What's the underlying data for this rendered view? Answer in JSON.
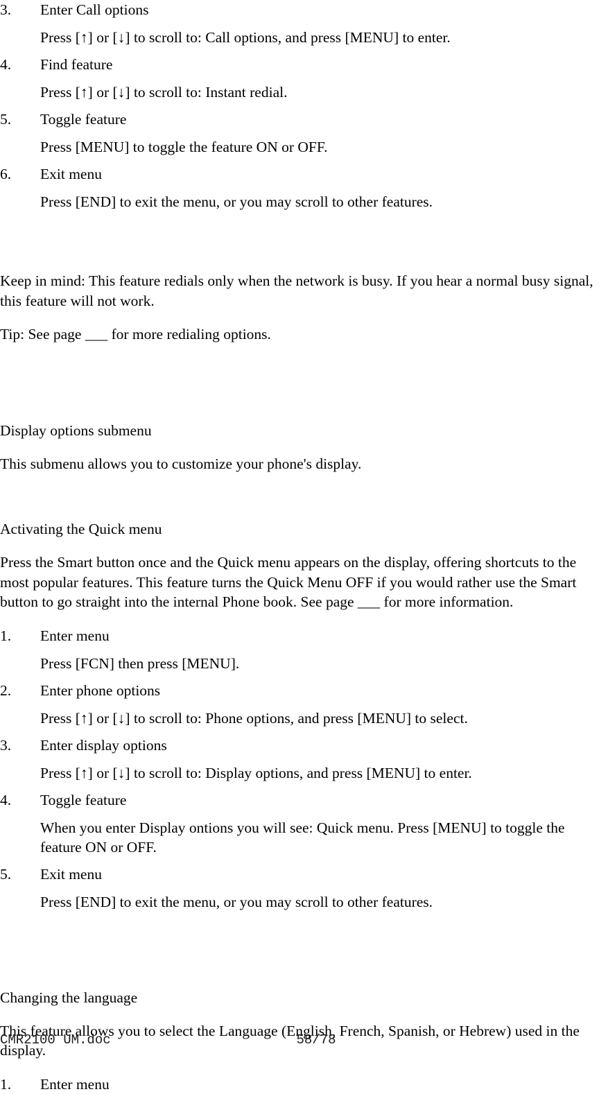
{
  "document": {
    "sections": [
      {
        "id": "instant-redial-steps",
        "steps": [
          {
            "num": "3.",
            "title": "Enter Call options",
            "body": "Press [↑] or [↓] to scroll to: Call options, and press [MENU] to enter."
          },
          {
            "num": "4.",
            "title": "Find feature",
            "body": "Press [↑] or [↓] to scroll to: Instant redial."
          },
          {
            "num": "5.",
            "title": "Toggle feature",
            "body": "Press [MENU] to toggle the feature ON or OFF."
          },
          {
            "num": "6.",
            "title": "Exit menu",
            "body": "Press [END] to exit the menu, or you may scroll to other features."
          }
        ]
      }
    ],
    "keep_in_mind": "Keep in mind:  This feature redials only when the network is busy. If you hear a normal busy signal, this feature will not work.",
    "tip": "Tip:  See page ___ for more redialing options.",
    "display_options": {
      "heading": "Display options submenu",
      "intro": "This submenu allows you to customize your phone's display."
    },
    "quick_menu": {
      "heading": "Activating the Quick menu",
      "intro": "Press the Smart button once and the Quick menu appears on the display, offering shortcuts to the most popular features. This feature turns the Quick Menu OFF if you would rather use the Smart button to go straight into the internal Phone book. See page ___ for more information.",
      "steps": [
        {
          "num": "1.",
          "title": "Enter menu",
          "body": "Press [FCN] then press [MENU]."
        },
        {
          "num": "2.",
          "title": "Enter phone options",
          "body": "Press [↑] or [↓] to scroll to: Phone options, and press [MENU] to select."
        },
        {
          "num": "3.",
          "title": "Enter display options",
          "body": "Press [↑] or [↓] to scroll to: Display options, and press [MENU] to enter."
        },
        {
          "num": "4.",
          "title": "Toggle feature",
          "body": "When you enter Display ontions you will see: Quick menu. Press [MENU] to toggle the feature ON or OFF."
        },
        {
          "num": "5.",
          "title": "Exit menu",
          "body": "Press [END] to exit the menu, or you may scroll to other features."
        }
      ]
    },
    "language": {
      "heading": "Changing the language",
      "intro": "This feature allows you to select the Language (English, French, Spanish, or Hebrew) used in the display.",
      "steps": [
        {
          "num": "1.",
          "title": "Enter menu"
        }
      ]
    },
    "footer": {
      "doc_name": "CMR2100 UM.doc",
      "page_number": "58/78"
    }
  }
}
